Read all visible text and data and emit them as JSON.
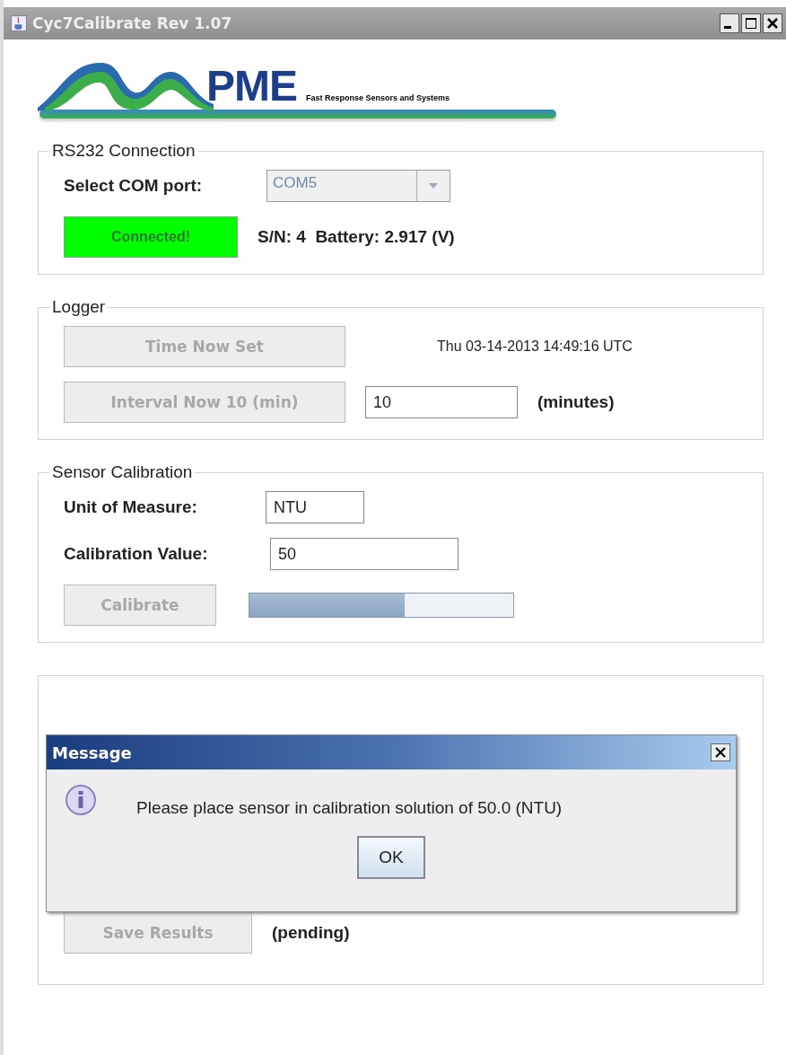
{
  "window": {
    "title": "Cyc7Calibrate Rev 1.07"
  },
  "logo": {
    "brand": "PME",
    "tagline": "Fast Response Sensors and Systems"
  },
  "rs232": {
    "title": "RS232 Connection",
    "port_label": "Select COM port:",
    "port": {
      "value": "COM5",
      "disabled": true
    },
    "connect_button": {
      "label": "Connected!",
      "disabled": true
    },
    "status": "S/N: 4  Battery: 2.917 (V)"
  },
  "logger": {
    "title": "Logger",
    "time_button": {
      "label": "Time Now Set",
      "disabled": true
    },
    "time": "Thu 03-14-2013 14:49:16 UTC",
    "interval_button": {
      "label": "Interval Now 10 (min)",
      "disabled": true
    },
    "interval_value": "10",
    "interval_unit": "(minutes)"
  },
  "sensor_calibration": {
    "title": "Sensor Calibration",
    "unit_label": "Unit of Measure:",
    "unit_value": "NTU",
    "value_label": "Calibration Value:",
    "value": "50",
    "calibrate_button": {
      "label": "Calibrate",
      "disabled": true
    },
    "progress": {
      "level": 0.59
    }
  },
  "calibration_results": {
    "save_button": {
      "label": "Save Results",
      "disabled": true
    },
    "status": "(pending)"
  },
  "dialog": {
    "title": "Message",
    "message": "Please place sensor in calibration solution of 50.0 (NTU)",
    "ok": "OK"
  }
}
